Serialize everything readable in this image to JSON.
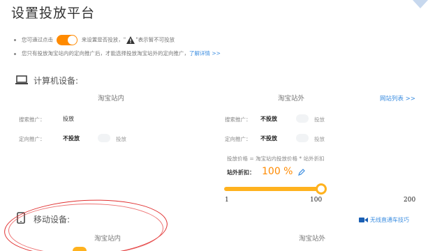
{
  "page_title": "设置投放平台",
  "notes": {
    "line1_before": "您可通过点击",
    "line1_mid": "来设置是否投放，\"",
    "line1_after": "\"表示暂不可投放",
    "line2_text": "您只有投放淘宝站内的定向推广后，才能选择投放淘宝站外的定向推广，",
    "line2_link": "了解详情 >>"
  },
  "pc": {
    "section_title": "计算机设备:",
    "col_inside": "淘宝站内",
    "col_outside": "淘宝站外",
    "site_list_link": "网站列表 >>",
    "inside_rows": [
      {
        "label": "搜索推广：",
        "value": "投放",
        "option": ""
      },
      {
        "label": "定向推广：",
        "value": "不投放",
        "option": "投放"
      }
    ],
    "outside_rows": [
      {
        "label": "搜索推广：",
        "value": "不投放",
        "option": "投放"
      },
      {
        "label": "定向推广：",
        "value": "不投放",
        "option": "投放"
      }
    ],
    "formula": "投放价格 = 淘宝站内投放价格 * 站外折扣",
    "discount_label": "站外折扣：",
    "discount_value": "100 %",
    "slider": {
      "min": "1",
      "mid": "100",
      "max": "200",
      "value": 100
    }
  },
  "mobile": {
    "section_title": "移动设备:",
    "col_inside": "淘宝站内",
    "col_outside": "淘宝站外",
    "wireless_link": "无线直通车技巧"
  },
  "colors": {
    "accent": "#ff8a00",
    "slider": "#ffb21e",
    "link": "#3b8de0",
    "annotation": "#e03030"
  }
}
